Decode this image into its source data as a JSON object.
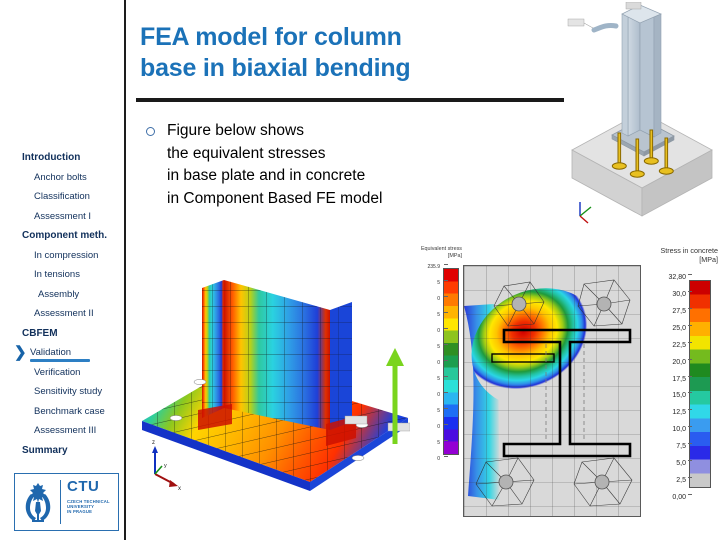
{
  "slide": {
    "title_lines": [
      "FEA model for column",
      "base in biaxial bending"
    ],
    "title_color": "#1b72b8"
  },
  "sidebar": {
    "items": [
      {
        "label": "Introduction",
        "style": "head",
        "active": false
      },
      {
        "label": "Anchor bolts",
        "style": "sub",
        "active": false
      },
      {
        "label": "Classification",
        "style": "sub",
        "active": false
      },
      {
        "label": "Assessment I",
        "style": "sub",
        "active": false
      },
      {
        "label": "Component meth.",
        "style": "head",
        "active": false
      },
      {
        "label": "In compression",
        "style": "sub",
        "active": false
      },
      {
        "label": "In tensions",
        "style": "sub",
        "active": false
      },
      {
        "label": "Assembly",
        "style": "sub2",
        "active": false
      },
      {
        "label": "Assessment II",
        "style": "sub",
        "active": false
      },
      {
        "label": "CBFEM",
        "style": "head",
        "active": false
      },
      {
        "label": "Validation",
        "style": "active",
        "active": true
      },
      {
        "label": "Verification",
        "style": "sub",
        "active": false
      },
      {
        "label": "Sensitivity study",
        "style": "sub",
        "active": false
      },
      {
        "label": "Benchmark case",
        "style": "sub",
        "active": false
      },
      {
        "label": "Assessment III",
        "style": "sub",
        "active": false
      },
      {
        "label": "Summary",
        "style": "head",
        "active": false
      }
    ],
    "accent_color": "#2d7fc4",
    "text_color": "#11305b"
  },
  "logo": {
    "abbr": "CTU",
    "line1": "CZECH TECHNICAL",
    "line2": "UNIVERSITY",
    "line3": "IN PRAGUE",
    "color": "#1f67ad"
  },
  "body": {
    "bullet_marker": "circle-outline-bullet",
    "lines": [
      "Figure below shows",
      "the equivalent stresses",
      "in base plate and in concrete",
      "in Component Based FE model"
    ]
  },
  "figures": {
    "iso_model": {
      "name": "3d-column-base-isometric",
      "description": "I-section column on base plate with four anchor bolts in concrete block",
      "axis_triad": [
        "x",
        "y",
        "z"
      ]
    },
    "fea_plate": {
      "name": "fea-base-plate-equivalent-stress",
      "description": "Deformed FE mesh of base plate and column with rainbow equivalent stress contours",
      "axis_triad": [
        "x",
        "y",
        "z"
      ]
    },
    "concrete_plan": {
      "name": "concrete-stress-plan-view",
      "description": "Plan view of concrete block contact stresses under base plate with I-profile outline and four anchor bolts",
      "bolt_count": 4
    }
  },
  "chart_data": [
    {
      "type": "colorbar",
      "name": "equivalent-stress-legend",
      "title": "Equivalent stress",
      "unit": "[MPa]",
      "max_label": "235.9",
      "tick_labels": [
        "235.9",
        "5",
        "0",
        "5",
        "0",
        "5",
        "0",
        "5",
        "0",
        "5",
        "0",
        "5",
        "0"
      ],
      "colormap": [
        "#9400d3",
        "#4b0ce0",
        "#1a2ff0",
        "#1e6ef5",
        "#2bb6f0",
        "#2ce0d8",
        "#28c79a",
        "#1c9e4e",
        "#2f8f23",
        "#8ec41e",
        "#ffe600",
        "#ffb400",
        "#ff7a00",
        "#ff3c00",
        "#e00000"
      ],
      "grid": false,
      "legend_position": "left-of-plot"
    },
    {
      "type": "colorbar",
      "name": "concrete-stress-legend",
      "title": "Stress in concrete",
      "unit": "[MPa]",
      "tick_labels": [
        "32,80",
        "30,0",
        "27,5",
        "25,0",
        "22,5",
        "20,0",
        "17,5",
        "15,0",
        "12,5",
        "10,0",
        "7,5",
        "5,0",
        "2,5",
        "0,00"
      ],
      "values": [
        32.8,
        30.0,
        27.5,
        25.0,
        22.5,
        20.0,
        17.5,
        15.0,
        12.5,
        10.0,
        7.5,
        5.0,
        2.5,
        0.0
      ],
      "ylim": [
        0.0,
        32.8
      ],
      "colormap": [
        "#c9c9c9",
        "#8f8fe0",
        "#2a2ae8",
        "#2a5cf0",
        "#3a9cf0",
        "#30d8e8",
        "#25c9a0",
        "#1d9a52",
        "#1f8a1f",
        "#74bb1e",
        "#f2e400",
        "#ffb000",
        "#ff7000",
        "#f03000",
        "#cc0000"
      ],
      "grid": false,
      "legend_position": "right"
    }
  ]
}
